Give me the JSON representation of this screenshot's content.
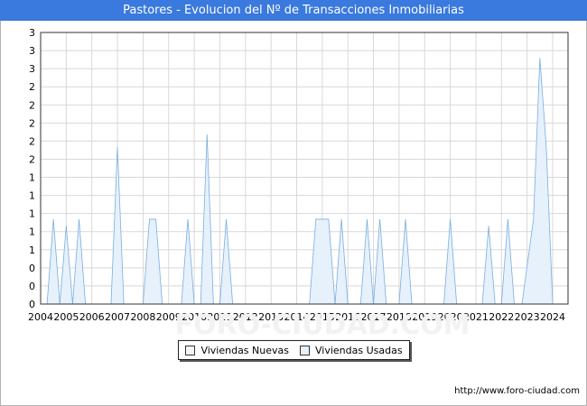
{
  "title": "Pastores - Evolucion del Nº de Transacciones Inmobiliarias",
  "footer": "http://www.foro-ciudad.com",
  "watermark": "FORO-CIUDAD.COM",
  "colors": {
    "title_bg": "#3a79dd",
    "grid": "#d8d8d8",
    "new_fill": "#f4f4f4",
    "used_fill": "#e6f1fc",
    "used_line": "#7aaee0"
  },
  "chart_data": {
    "type": "area",
    "title": "Pastores - Evolucion del Nº de Transacciones Inmobiliarias",
    "xlabel": "",
    "ylabel": "",
    "xlim": [
      2004,
      2024.6
    ],
    "ylim": [
      0,
      3.2
    ],
    "x_ticks": [
      "2004",
      "2005",
      "2006",
      "2007",
      "2008",
      "2009",
      "2010",
      "2011",
      "2012",
      "2013",
      "2014",
      "2015",
      "2016",
      "2017",
      "2018",
      "2019",
      "2020",
      "2021",
      "2022",
      "2023",
      "2024"
    ],
    "y_ticks": [
      "0",
      "0",
      "0",
      "1",
      "1",
      "1",
      "1",
      "1",
      "2",
      "2",
      "2",
      "2",
      "2",
      "3",
      "3",
      "3"
    ],
    "grid": true,
    "legend": {
      "placement": "bottom-center",
      "entries": [
        "Viviendas Nuevas",
        "Viviendas Usadas"
      ]
    },
    "series": [
      {
        "name": "Viviendas Nuevas",
        "x": [
          2004,
          2024.5
        ],
        "y": [
          0,
          0
        ]
      },
      {
        "name": "Viviendas Usadas",
        "x": [
          2004.25,
          2004.5,
          2004.75,
          2004.75,
          2005.0,
          2005.25,
          2005.25,
          2005.5,
          2005.75,
          2006.75,
          2007.0,
          2007.25,
          2008.0,
          2008.25,
          2008.5,
          2008.75,
          2009.5,
          2009.75,
          2010.0,
          2010.25,
          2010.5,
          2010.75,
          2011.0,
          2011.25,
          2011.5,
          2014.5,
          2014.75,
          2015.0,
          2015.25,
          2015.5,
          2015.5,
          2015.75,
          2016.0,
          2016.5,
          2016.75,
          2017.0,
          2017.0,
          2017.25,
          2017.5,
          2018.0,
          2018.25,
          2018.5,
          2019.75,
          2020.0,
          2020.25,
          2021.25,
          2021.5,
          2021.75,
          2022.0,
          2022.25,
          2022.5,
          2022.8,
          2023.25,
          2023.5,
          2023.75,
          2024.0
        ],
        "y": [
          0,
          1,
          0,
          0,
          0.92,
          0,
          0,
          1,
          0,
          0,
          1.85,
          0,
          0,
          1,
          1,
          0,
          0,
          1,
          0,
          0,
          2.0,
          0,
          0,
          1,
          0,
          0,
          1,
          1,
          1,
          0,
          0,
          1,
          0,
          0,
          1,
          0,
          0,
          1,
          0,
          0,
          1,
          0,
          0,
          1,
          0,
          0,
          0.92,
          0,
          0,
          1,
          0,
          0,
          1,
          2.9,
          1.85,
          0
        ]
      }
    ]
  }
}
